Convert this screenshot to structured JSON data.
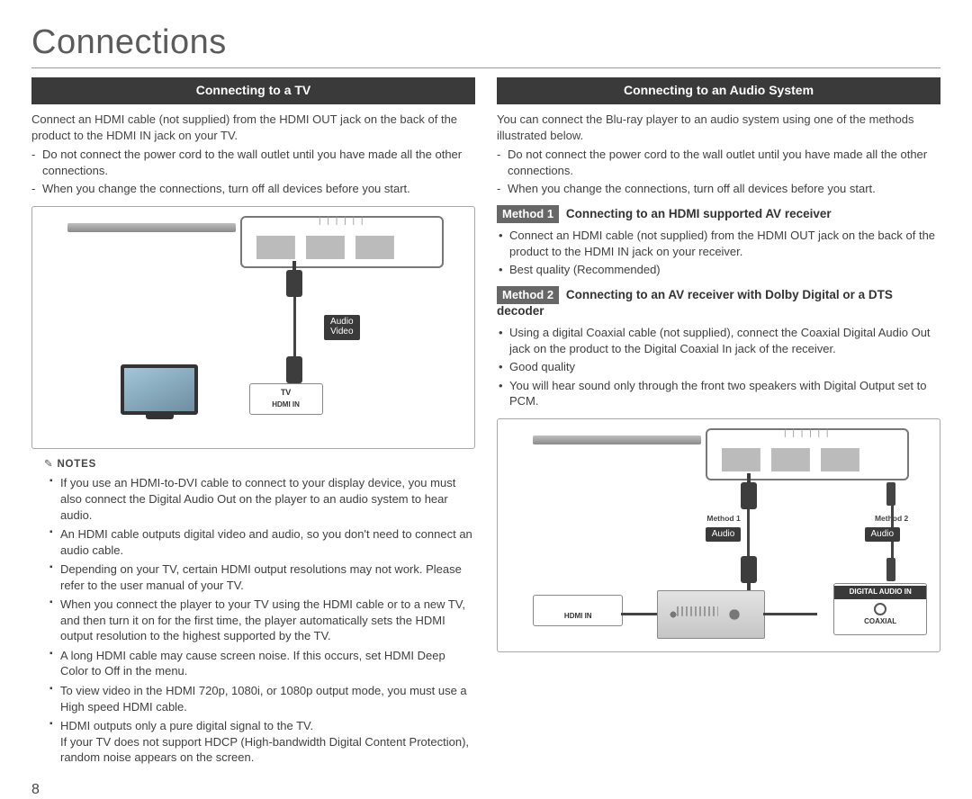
{
  "page_title": "Connections",
  "page_number": "8",
  "left": {
    "section_title": "Connecting to a TV",
    "lead": "Connect an HDMI cable (not supplied) from the HDMI OUT jack on the back of the product to the HDMI IN jack on your TV.",
    "cautions": [
      "Do not connect the power cord to the wall outlet until you have made all the other connections.",
      "When you change the connections, turn off all devices before you start."
    ],
    "diagram": {
      "cable_label": "Audio\nVideo",
      "tv_label": "TV",
      "tv_port": "HDMI IN"
    },
    "notes_heading": "NOTES",
    "notes": [
      "If you use an HDMI-to-DVI cable to connect to your display device, you must also connect the Digital Audio Out on the player to an audio system to hear audio.",
      "An HDMI cable outputs digital video and audio, so you don't need to connect an audio cable.",
      "Depending on your TV, certain HDMI output resolutions may not work. Please refer to the user manual of your TV.",
      "When you connect the player to your TV using the HDMI cable or to a new TV, and then turn it on for the first time, the player automatically sets the HDMI output resolution to the highest supported by the TV.",
      "A long HDMI cable may cause screen noise. If this occurs, set HDMI Deep Color to Off in the menu.",
      "To view video in the HDMI 720p, 1080i, or 1080p output mode, you must use a High speed HDMI cable.",
      "HDMI outputs only a pure digital signal to the TV.\nIf your TV does not support HDCP (High-bandwidth Digital Content Protection), random noise appears on the screen."
    ]
  },
  "right": {
    "section_title": "Connecting to an Audio System",
    "lead": "You can connect the Blu-ray player to an audio system using one of the methods illustrated below.",
    "cautions": [
      "Do not connect the power cord to the wall outlet until you have made all the other connections.",
      "When you change the connections, turn off all devices before you start."
    ],
    "method1_tag": "Method 1",
    "method1_title": "Connecting to an HDMI supported AV receiver",
    "method1_points": [
      "Connect an HDMI cable (not supplied) from the HDMI OUT jack on the back of the product to the HDMI IN jack on your receiver.",
      "Best quality (Recommended)"
    ],
    "method2_tag": "Method 2",
    "method2_title": "Connecting to an AV receiver with Dolby Digital or a DTS decoder",
    "method2_points": [
      "Using a digital Coaxial cable (not supplied), connect the Coaxial Digital Audio Out jack on the product to the Digital Coaxial In jack of the receiver.",
      "Good quality",
      "You will hear sound only through the front two speakers with Digital Output set to PCM."
    ],
    "diagram": {
      "m1_caption": "Method 1",
      "m1_label": "Audio",
      "m2_caption": "Method 2",
      "m2_label": "Audio",
      "hdmi_in": "HDMI IN",
      "dig_audio_in": "DIGITAL AUDIO IN",
      "coaxial": "COAXIAL"
    }
  }
}
